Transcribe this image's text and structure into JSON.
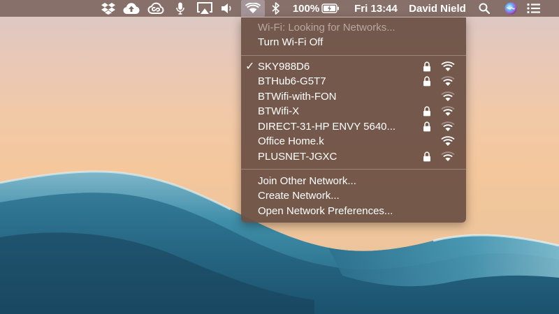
{
  "menubar": {
    "icons": [
      "dropbox-icon",
      "cloud-upload-icon",
      "creative-cloud-icon",
      "microphone-icon",
      "airplay-icon",
      "volume-icon",
      "wifi-icon",
      "bluetooth-icon",
      "battery-icon",
      "search-icon",
      "siri-icon",
      "notification-center-icon"
    ],
    "battery": "100%",
    "clock": "Fri 13:44",
    "user": "David Nield"
  },
  "wifi_menu": {
    "status": "Wi-Fi: Looking for Networks...",
    "toggle": "Turn Wi-Fi Off",
    "networks": [
      {
        "name": "SKY988D6",
        "connected": true,
        "secured": true
      },
      {
        "name": "BTHub6-G5T7",
        "connected": false,
        "secured": true
      },
      {
        "name": "BTWifi-with-FON",
        "connected": false,
        "secured": false
      },
      {
        "name": "BTWifi-X",
        "connected": false,
        "secured": true
      },
      {
        "name": "DIRECT-31-HP ENVY 5640...",
        "connected": false,
        "secured": true
      },
      {
        "name": "Office Home.k",
        "connected": false,
        "secured": false
      },
      {
        "name": "PLUSNET-JGXC",
        "connected": false,
        "secured": true
      }
    ],
    "checkmark": "✓",
    "actions": [
      "Join Other Network...",
      "Create Network...",
      "Open Network Preferences..."
    ]
  },
  "colors": {
    "menubar_bg": "#806862",
    "dropdown_bg": "#6a5044",
    "status_text": "#b9a79e"
  }
}
